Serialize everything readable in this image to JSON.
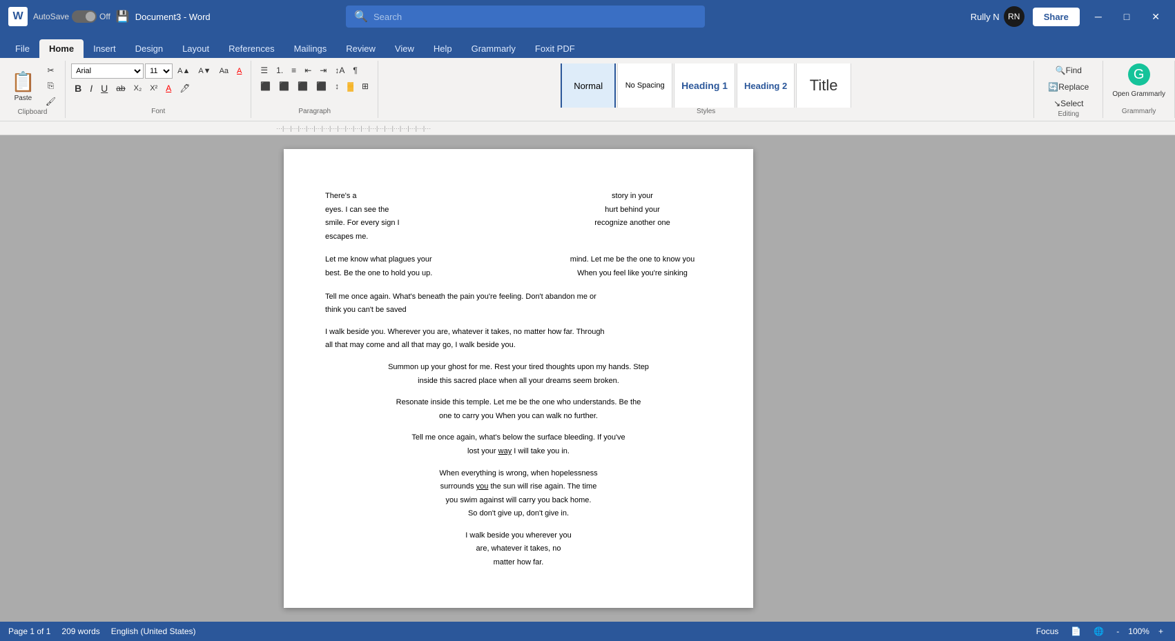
{
  "titlebar": {
    "app_name": "W",
    "autosave_label": "AutoSave",
    "autosave_state": "Off",
    "save_icon": "💾",
    "doc_title": "Document3 - Word",
    "search_placeholder": "Search",
    "user_name": "Rully N",
    "minimize_label": "─",
    "maximize_label": "□",
    "close_label": "✕",
    "share_label": "Share"
  },
  "ribbon_tabs": [
    {
      "label": "File",
      "active": false
    },
    {
      "label": "Home",
      "active": true
    },
    {
      "label": "Insert",
      "active": false
    },
    {
      "label": "Design",
      "active": false
    },
    {
      "label": "Layout",
      "active": false
    },
    {
      "label": "References",
      "active": false
    },
    {
      "label": "Mailings",
      "active": false
    },
    {
      "label": "Review",
      "active": false
    },
    {
      "label": "View",
      "active": false
    },
    {
      "label": "Help",
      "active": false
    },
    {
      "label": "Grammarly",
      "active": false
    },
    {
      "label": "Foxit PDF",
      "active": false
    }
  ],
  "toolbar": {
    "clipboard": {
      "paste_label": "Paste",
      "cut_icon": "✂",
      "copy_icon": "⎘",
      "format_painter_icon": "🖌",
      "group_label": "Clipboard"
    },
    "font": {
      "font_name": "Arial",
      "font_size": "11",
      "grow_icon": "A↑",
      "shrink_icon": "A↓",
      "case_icon": "Aa",
      "clear_icon": "A",
      "bold": "B",
      "italic": "I",
      "underline": "U",
      "strikethrough": "ab",
      "subscript": "X₂",
      "superscript": "X²",
      "font_color": "A",
      "highlight": "🖊",
      "group_label": "Font"
    },
    "paragraph": {
      "bullets_icon": "☰",
      "numbering_icon": "1.",
      "multilevel_icon": "≡",
      "decrease_indent": "⇤",
      "increase_indent": "⇥",
      "sort_icon": "↕",
      "show_all_icon": "¶",
      "align_left": "≡",
      "align_center": "≡",
      "align_right": "≡",
      "justify": "≡",
      "line_spacing": "↕",
      "shading": "🎨",
      "borders": "⊞",
      "group_label": "Paragraph"
    },
    "styles": {
      "normal_label": "Normal",
      "no_spacing_label": "No Spacing",
      "heading1_label": "Heading 1",
      "heading2_label": "Heading 2",
      "title_label": "Title",
      "group_label": "Styles"
    },
    "editing": {
      "find_label": "Find",
      "replace_label": "Replace",
      "select_label": "Select",
      "group_label": "Editing"
    },
    "grammarly": {
      "open_label": "Open Grammarly",
      "group_label": "Grammarly"
    }
  },
  "document": {
    "content": {
      "stanza1_left_line1": "There's a",
      "stanza1_left_line2": "eyes. I can see the",
      "stanza1_left_line3": "smile. For every sign I",
      "stanza1_left_line4": "escapes me.",
      "stanza1_right_line1": "story in your",
      "stanza1_right_line2": "hurt behind your",
      "stanza1_right_line3": "recognize another one",
      "stanza2_left_line1": "Let me know what plagues your",
      "stanza2_left_line2": "best. Be the one to hold you up.",
      "stanza2_right_line1": "mind. Let me be the one to know you",
      "stanza2_right_line2": "When you feel like you're sinking",
      "stanza3_line1": "Tell me once again. What's beneath the pain you're feeling. Don't abandon me or",
      "stanza3_line2": "think you can't be saved",
      "stanza4_line1": "I walk beside you. Wherever you are, whatever it takes, no matter how far. Through",
      "stanza4_line2": "all that may come and all that may go, I walk beside you.",
      "stanza5_line1": "Summon up your ghost for me. Rest your tired thoughts upon my hands. Step",
      "stanza5_line2": "inside this sacred place when all your dreams seem broken.",
      "stanza6_line1": "Resonate inside this temple. Let me be the one who understands. Be the",
      "stanza6_line2": "one to carry you When you can walk no further.",
      "stanza7_line1": "Tell me once again, what's below the surface bleeding. If you've",
      "stanza7_line2": "lost your way I will take you in.",
      "stanza8_line1": "When everything is wrong, when hopelessness",
      "stanza8_line2": "surrounds you the sun will rise again. The time",
      "stanza8_line3": "you swim against will carry you back home.",
      "stanza8_line4": "So don't give up, don't give in.",
      "stanza9_line1": "I walk beside you wherever you",
      "stanza9_line2": "are, whatever it takes, no",
      "stanza9_line3": "matter how far."
    }
  },
  "statusbar": {
    "page_info": "Page 1 of 1",
    "word_count": "209 words",
    "language": "English (United States)",
    "focus_label": "Focus",
    "view_print_icon": "📄",
    "view_web_icon": "🌐",
    "zoom_out": "-",
    "zoom_in": "+",
    "zoom_level": "100%"
  }
}
